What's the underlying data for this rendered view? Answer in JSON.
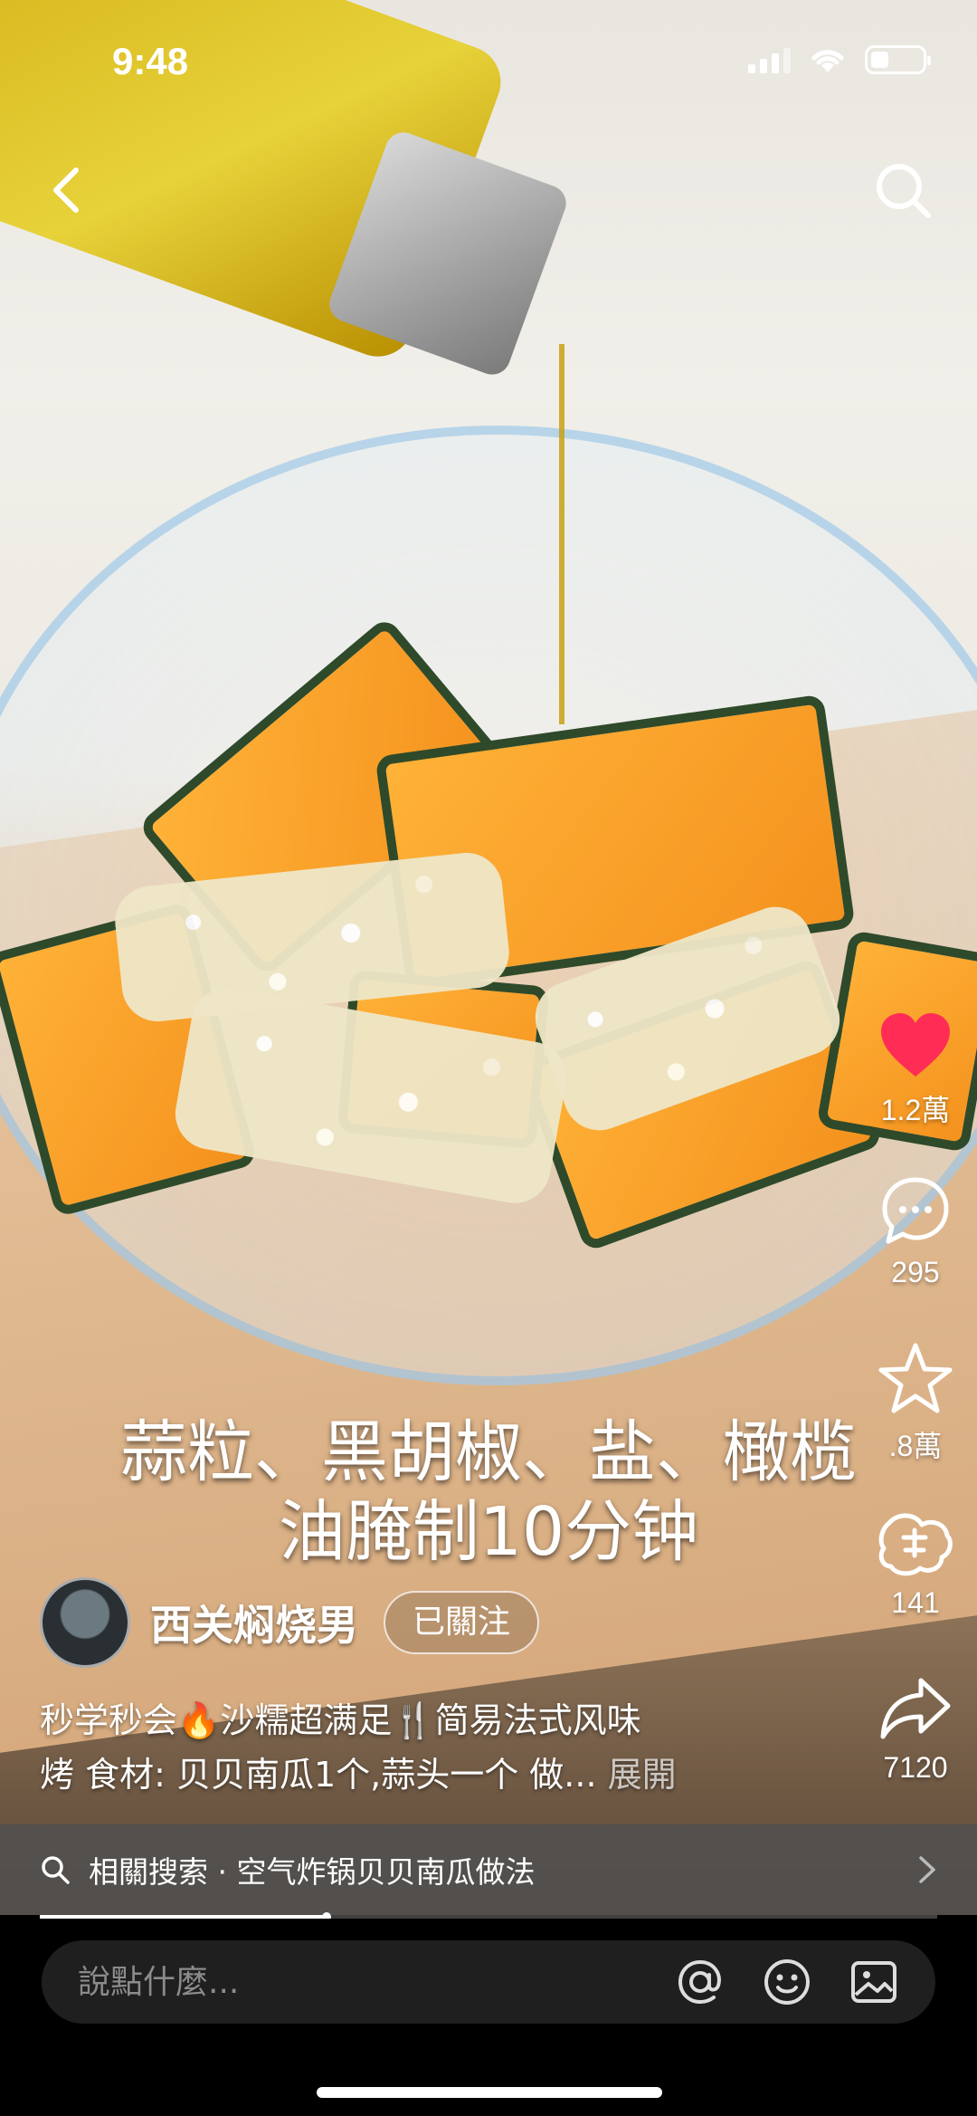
{
  "status": {
    "time": "9:48",
    "battery_level": 0.35
  },
  "caption": {
    "line1": "蒜粒、黑胡椒、盐、橄榄",
    "line2": "油腌制10分钟"
  },
  "author": {
    "name": "西关焖烧男",
    "follow_label": "已關注"
  },
  "description": {
    "line1": "秒学秒会🔥沙糯超满足🍴简易法式风味",
    "line2": "烤 食材: 贝贝南瓜1个,蒜头一个 做...",
    "expand": "展開"
  },
  "actions": {
    "like_count": "1.2萬",
    "comment_count": "295",
    "collect_count": ".8萬",
    "weixin_count": "141",
    "share_count": "7120",
    "like_color": "#ff2d55"
  },
  "related_search": {
    "label": "相關搜索 · 空气炸锅贝贝南瓜做法"
  },
  "progress": {
    "value": 0.32
  },
  "comment": {
    "placeholder": "說點什麼..."
  },
  "icons": [
    "back-icon",
    "search-icon",
    "heart-icon",
    "comment-icon",
    "star-icon",
    "weixin-icon",
    "share-icon",
    "at-icon",
    "emoji-icon",
    "image-icon"
  ]
}
